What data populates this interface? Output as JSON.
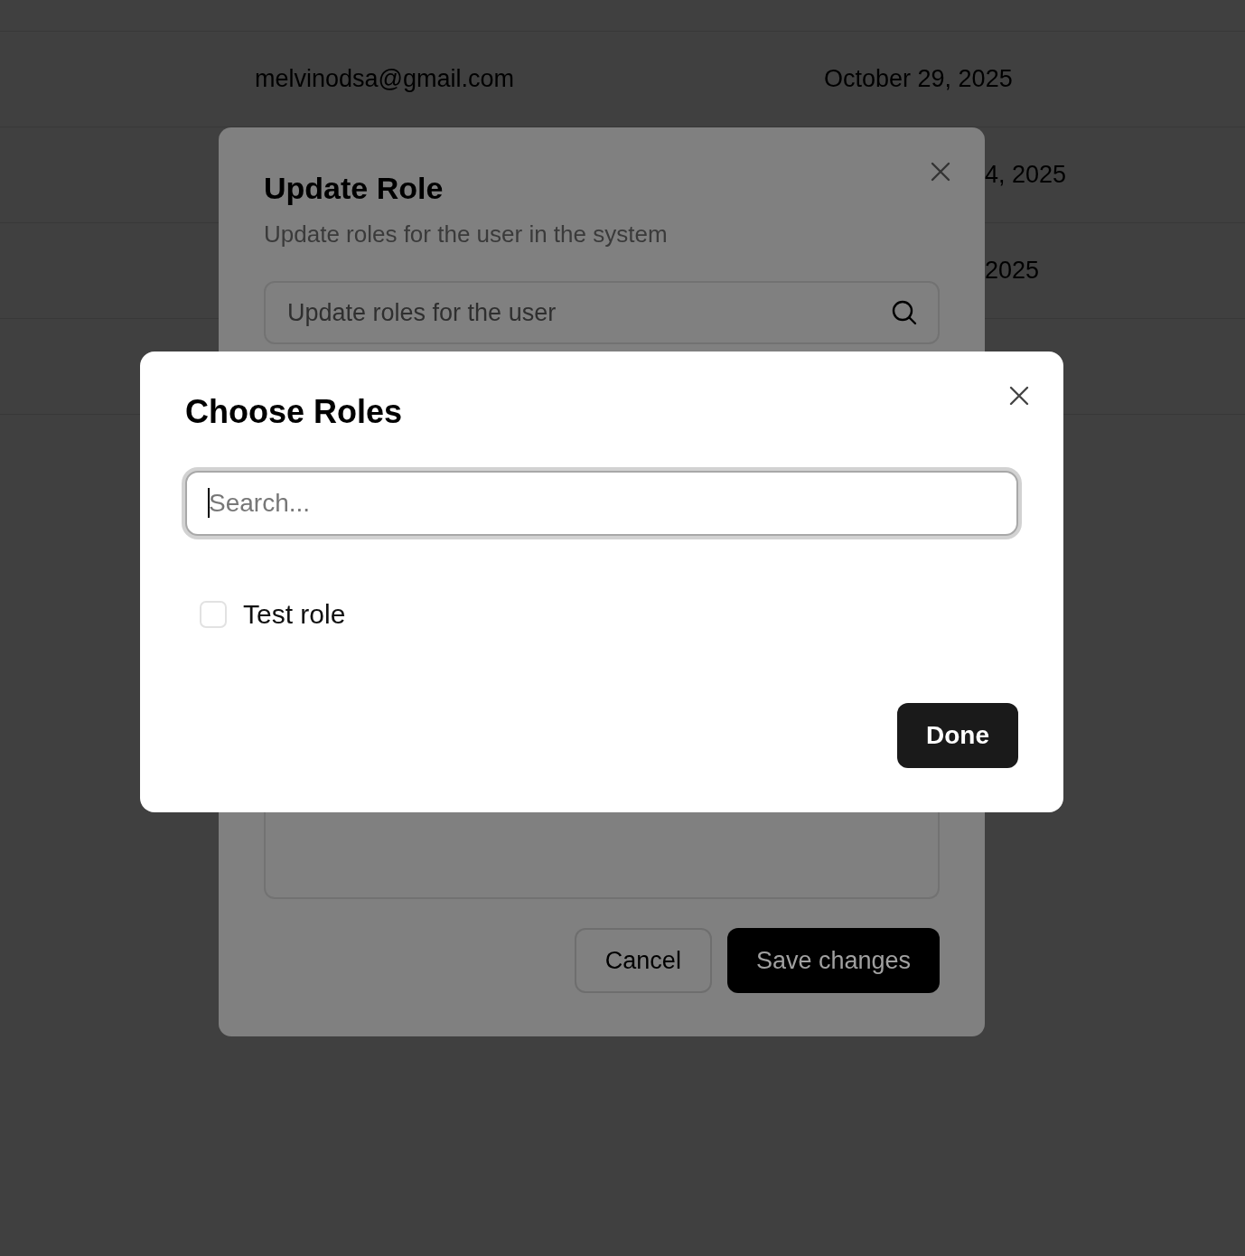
{
  "table": {
    "rows": [
      {
        "kind": "full",
        "email": "melvinodsa@gmail.com",
        "updated_at": "October 29, 2025"
      },
      {
        "kind": "partial",
        "updated_at": "4, 2025"
      },
      {
        "kind": "partial",
        "updated_at": "2025"
      },
      {
        "kind": "hidden"
      }
    ]
  },
  "update_dialog": {
    "title": "Update Role",
    "subtitle": "Update roles for the user in the system",
    "search": {
      "placeholder": "Update roles for the user"
    },
    "buttons": [
      {
        "kind": "outline",
        "label": "Cancel"
      },
      {
        "kind": "primary",
        "label": "Save changes"
      }
    ]
  },
  "choose_dialog": {
    "title": "Choose Roles",
    "search": {
      "placeholder": "Search...",
      "focused": true
    },
    "roles": [
      {
        "label": "Test role",
        "checked": false
      }
    ],
    "done": "Done"
  }
}
